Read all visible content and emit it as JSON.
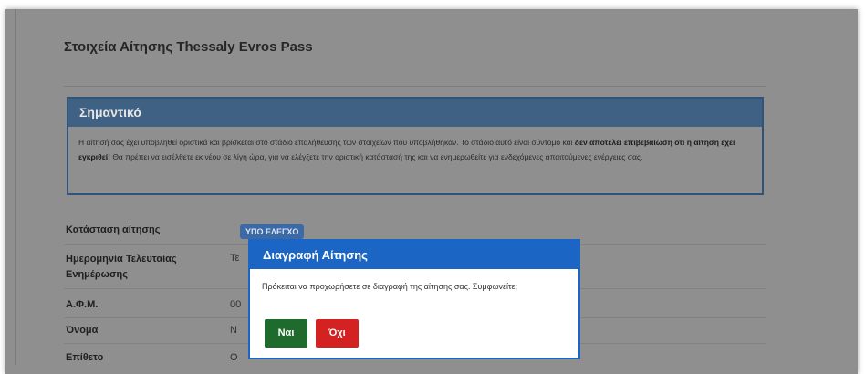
{
  "page": {
    "title": "Στοιχεία Αίτησης Thessaly Evros Pass"
  },
  "notice": {
    "heading": "Σημαντικό",
    "text_part1": "Η αίτησή σας έχει υποβληθεί οριστικά και βρίσκεται στο στάδιο επαλήθευσης των στοιχείων που υποβλήθηκαν. Το στάδιο αυτό είναι σύντομο και ",
    "text_bold": "δεν αποτελεί επιβεβαίωση ότι η αίτηση έχει εγκριθεί!",
    "text_part2": " Θα πρέπει να εισέλθετε εκ νέου σε λίγη ώρα, για να ελέγξετε την οριστική κατάστασή της και να ενημερωθείτε για ενδεχόμενες απαιτούμενες ενέργειές σας."
  },
  "details": {
    "status_label": "Κατάσταση αίτησης",
    "status_badge": "ΥΠΟ ΕΛΕΓΧΟ",
    "last_update_label": "Ημερομηνία Τελευταίας Ενημέρωσης",
    "last_update_value": "Τε",
    "afm_label": "Α.Φ.Μ.",
    "afm_value": "00",
    "first_name_label": "Όνομα",
    "first_name_value": "Ν",
    "last_name_label": "Επίθετο",
    "last_name_value": "Ο"
  },
  "modal": {
    "title": "Διαγραφή Αίτησης",
    "message": "Πρόκειται να προχωρήσετε σε διαγραφή της αίτησης σας. Συμφωνείτε;",
    "yes_label": "Ναι",
    "no_label": "Όχι"
  },
  "colors": {
    "modal_accent": "#1b66c4",
    "yes_button": "#1f6b2e",
    "no_button": "#d42222",
    "status_badge": "#3b6aa6"
  }
}
